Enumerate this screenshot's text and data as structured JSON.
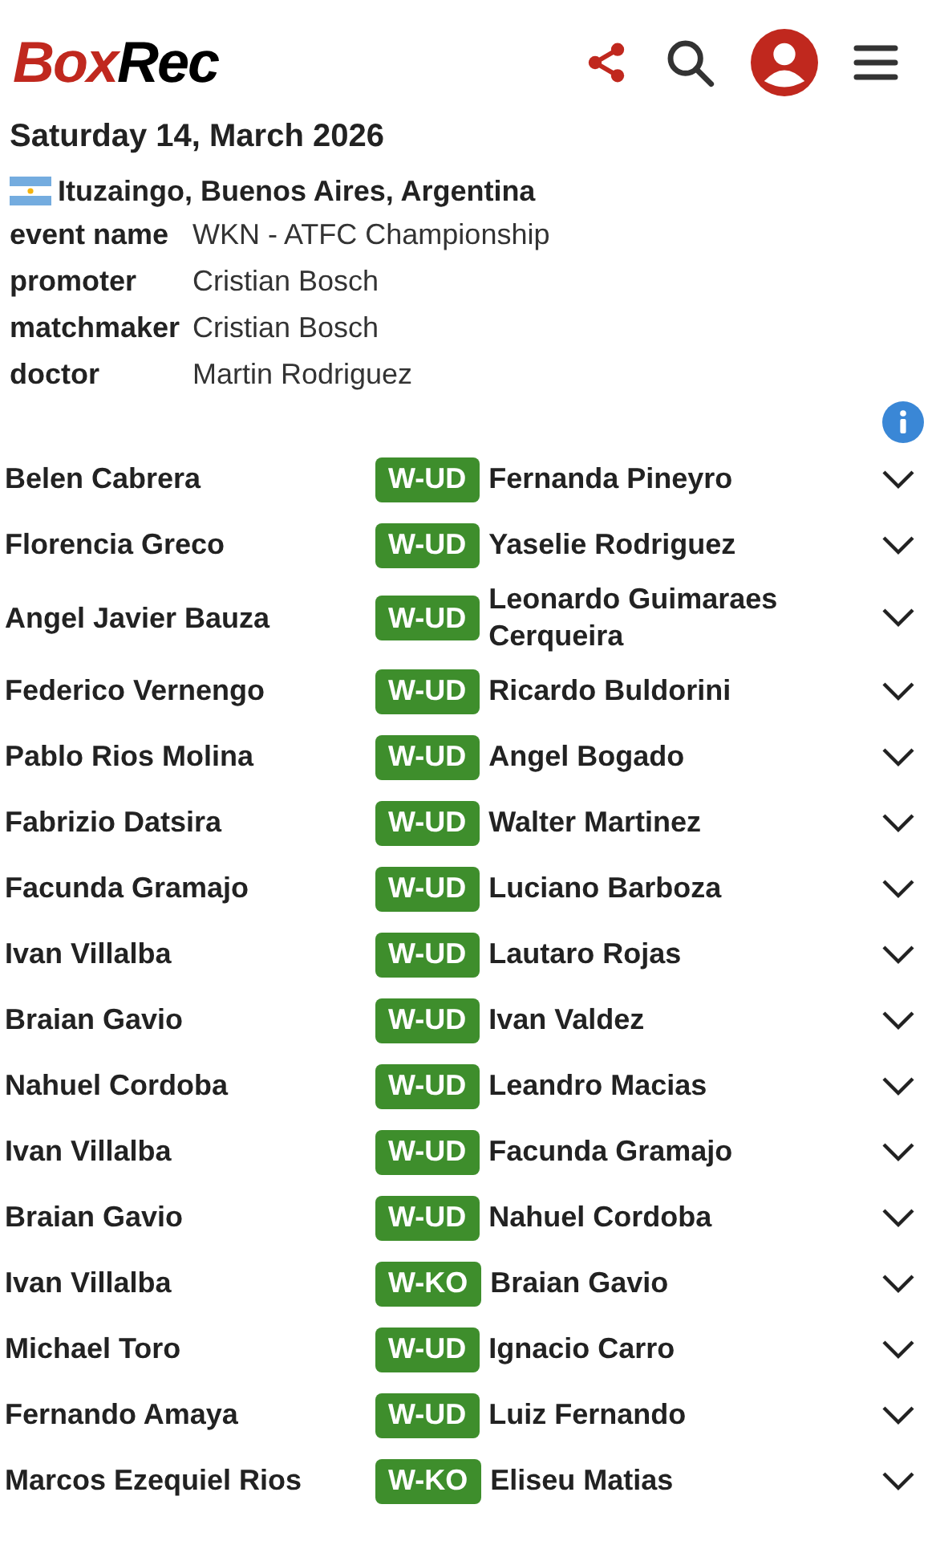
{
  "header": {
    "logo": [
      "Box",
      "Rec"
    ]
  },
  "event": {
    "date": "Saturday 14, March 2026",
    "location": "Ituzaingo, Buenos Aires, Argentina",
    "details": [
      {
        "label": "event name",
        "value": "WKN - ATFC Championship"
      },
      {
        "label": "promoter",
        "value": "Cristian Bosch"
      },
      {
        "label": "matchmaker",
        "value": "Cristian Bosch"
      },
      {
        "label": "doctor",
        "value": "Martin Rodriguez"
      }
    ]
  },
  "bouts": [
    {
      "winner": "Belen Cabrera",
      "result": "W-UD",
      "opponent": "Fernanda Pineyro"
    },
    {
      "winner": "Florencia Greco",
      "result": "W-UD",
      "opponent": "Yaselie Rodriguez"
    },
    {
      "winner": "Angel Javier Bauza",
      "result": "W-UD",
      "opponent": "Leonardo Guimaraes Cerqueira"
    },
    {
      "winner": "Federico Vernengo",
      "result": "W-UD",
      "opponent": "Ricardo Buldorini"
    },
    {
      "winner": "Pablo Rios Molina",
      "result": "W-UD",
      "opponent": "Angel Bogado"
    },
    {
      "winner": "Fabrizio Datsira",
      "result": "W-UD",
      "opponent": "Walter Martinez"
    },
    {
      "winner": "Facunda Gramajo",
      "result": "W-UD",
      "opponent": "Luciano Barboza"
    },
    {
      "winner": "Ivan Villalba",
      "result": "W-UD",
      "opponent": "Lautaro Rojas"
    },
    {
      "winner": "Braian Gavio",
      "result": "W-UD",
      "opponent": "Ivan Valdez"
    },
    {
      "winner": "Nahuel Cordoba",
      "result": "W-UD",
      "opponent": "Leandro Macias"
    },
    {
      "winner": "Ivan Villalba",
      "result": "W-UD",
      "opponent": "Facunda Gramajo"
    },
    {
      "winner": "Braian Gavio",
      "result": "W-UD",
      "opponent": "Nahuel Cordoba"
    },
    {
      "winner": "Ivan Villalba",
      "result": "W-KO",
      "opponent": "Braian Gavio"
    },
    {
      "winner": "Michael Toro",
      "result": "W-UD",
      "opponent": "Ignacio Carro"
    },
    {
      "winner": "Fernando Amaya",
      "result": "W-UD",
      "opponent": "Luiz Fernando"
    },
    {
      "winner": "Marcos Ezequiel Rios",
      "result": "W-KO",
      "opponent": "Eliseu Matias"
    }
  ]
}
